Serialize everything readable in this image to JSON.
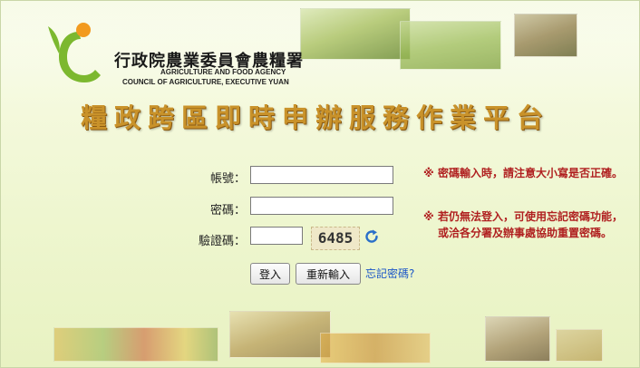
{
  "agency": {
    "name_zh": "行政院農業委員會農糧署",
    "name_en_line1": "AGRICULTURE AND FOOD AGENCY",
    "name_en_line2": "COUNCIL OF AGRICULTURE, EXECUTIVE YUAN"
  },
  "title": "糧政跨區即時申辦服務作業平台",
  "form": {
    "account_label": "帳號：",
    "account_value": "",
    "password_label": "密碼：",
    "password_value": "",
    "captcha_label": "驗證碼：",
    "captcha_value": "",
    "captcha_code": "6485",
    "refresh_icon": "refresh-icon"
  },
  "buttons": {
    "login": "登入",
    "reset": "重新輸入",
    "forgot": "忘記密碼?"
  },
  "notes": [
    {
      "mark": "※",
      "text": "密碼輸入時，請注意大小寫是否正確。"
    },
    {
      "mark": "※",
      "text": "若仍無法登入，可使用忘記密碼功能，或洽各分署及辦事處協助重置密碼。"
    }
  ],
  "colors": {
    "title": "#c9922a",
    "note": "#b02020",
    "link": "#1a55c8",
    "logo_green": "#7cb82f",
    "logo_orange": "#f29a1f"
  }
}
